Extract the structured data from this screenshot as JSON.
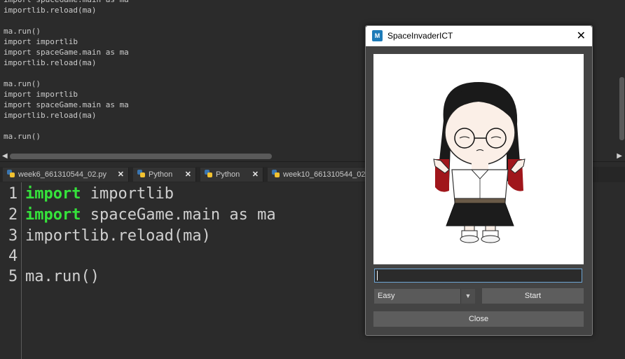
{
  "history": {
    "lines": [
      "import spaceGame.main as ma",
      "importlib.reload(ma)",
      "",
      "ma.run()",
      "import importlib",
      "import spaceGame.main as ma",
      "importlib.reload(ma)",
      "",
      "ma.run()",
      "import importlib",
      "import spaceGame.main as ma",
      "importlib.reload(ma)",
      "",
      "ma.run()"
    ]
  },
  "tabs": [
    {
      "label": "week6_661310544_02.py"
    },
    {
      "label": "Python"
    },
    {
      "label": "Python"
    },
    {
      "label": "week10_661310544_02"
    }
  ],
  "editor": {
    "line_numbers": [
      "1",
      "2",
      "3",
      "4",
      "5"
    ],
    "lines": [
      {
        "kw": "import",
        "rest": " importlib"
      },
      {
        "kw": "import",
        "rest": " spaceGame.main as ma"
      },
      {
        "kw": "",
        "rest": "importlib.reload(ma)"
      },
      {
        "kw": "",
        "rest": ""
      },
      {
        "kw": "",
        "rest": "ma.run()"
      }
    ],
    "keyword_color": "#35e33b"
  },
  "dialog": {
    "title": "SpaceInvaderICT",
    "app_icon_letter": "M",
    "name_input_value": "",
    "difficulty": "Easy",
    "start_label": "Start",
    "close_label": "Close",
    "accent": "#6ea5d4"
  }
}
